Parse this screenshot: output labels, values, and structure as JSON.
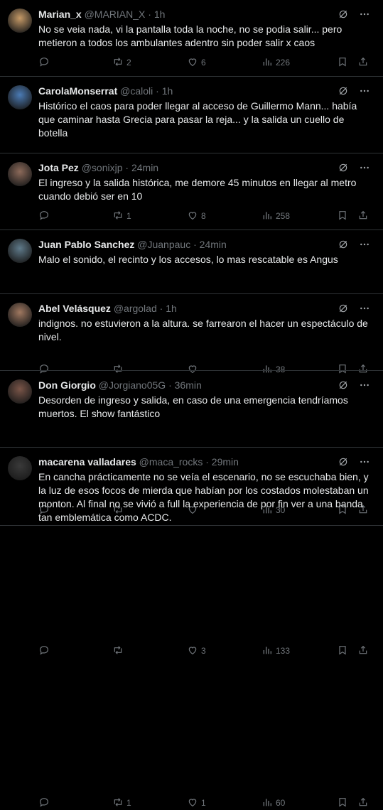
{
  "tweets": [
    {
      "name": "Marian_x",
      "handle": "@MARIAN_X",
      "time": "1h",
      "text": "No se veia nada, vi la pantalla toda la noche, no se podia salir... pero metieron a todos los ambulantes adentro sin poder salir x caos",
      "replies": "",
      "retweets": "2",
      "likes": "6",
      "views": "226",
      "avatar_color": "#c69a67"
    },
    {
      "name": "CarolaMonserrat",
      "handle": "@caloli",
      "time": "1h",
      "text": "Histórico el caos para poder llegar al acceso de Guillermo Mann... había que caminar hasta Grecia para pasar la reja... y la salida un cuello de botella",
      "replies": "",
      "retweets": "1",
      "likes": "8",
      "views": "258",
      "avatar_color": "#4b7bb5"
    },
    {
      "name": "Jota Pez",
      "handle": "@sonixjp",
      "time": "24min",
      "text": "El ingreso y la salida histórica, me demore 45 minutos en llegar al metro cuando debió ser en 10",
      "replies": "",
      "retweets": "",
      "likes": "",
      "views": "38",
      "avatar_color": "#8c6a5a"
    },
    {
      "name": "Juan Pablo Sanchez",
      "handle": "@Juanpauc",
      "time": "24min",
      "text": "Malo el sonido, el recinto y los accesos, lo mas rescatable es Angus",
      "replies": "",
      "retweets": "",
      "likes": "",
      "views": "30",
      "avatar_color": "#5f7a8a"
    },
    {
      "name": "Abel Velásquez",
      "handle": "@argolad",
      "time": "1h",
      "text": "indignos. no estuvieron a la altura. se farrearon el hacer un espectáculo de nivel.",
      "replies": "",
      "retweets": "",
      "likes": "3",
      "views": "133",
      "avatar_color": "#a07860"
    },
    {
      "name": "Don Giorgio",
      "handle": "@Jorgiano05G",
      "time": "36min",
      "text": "Desorden de ingreso y salida, en caso de una emergencia tendríamos muertos. El show fantástico",
      "replies": "",
      "retweets": "1",
      "likes": "1",
      "views": "60",
      "avatar_color": "#7a5548"
    },
    {
      "name": "macarena valladares",
      "handle": "@maca_rocks",
      "time": "29min",
      "text": "En cancha prácticamente no se veía el escenario, no se escuchaba bien, y la luz de esos focos de mierda que habían por los costados molestaban un monton. Al final no se vivió a full la experiencia de por fin ver a una banda tan emblemática como ACDC.",
      "replies": "",
      "retweets": "",
      "likes": "",
      "views": "",
      "avatar_color": "#3a3a3a"
    }
  ],
  "separator": "·",
  "icons": {
    "grok": "grok-icon",
    "more": "more-icon",
    "reply": "reply-icon",
    "retweet": "retweet-icon",
    "like": "like-icon",
    "views": "views-icon",
    "bookmark": "bookmark-icon",
    "share": "share-icon"
  }
}
